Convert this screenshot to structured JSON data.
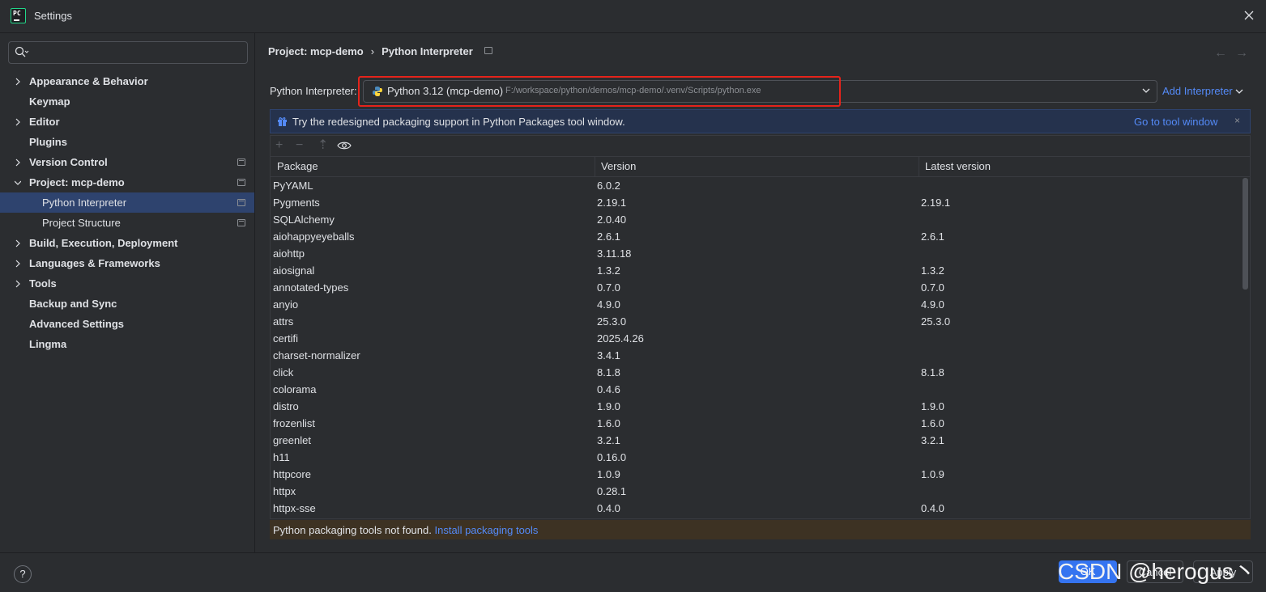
{
  "window": {
    "title": "Settings",
    "app_icon_text": "PC"
  },
  "sidebar": {
    "search_placeholder": "",
    "items": [
      {
        "label": "Appearance & Behavior",
        "expandable": true,
        "expanded": false,
        "level": 0,
        "selected": false,
        "project_icon": false
      },
      {
        "label": "Keymap",
        "expandable": false,
        "level": 0,
        "selected": false,
        "project_icon": false
      },
      {
        "label": "Editor",
        "expandable": true,
        "expanded": false,
        "level": 0,
        "selected": false,
        "project_icon": false
      },
      {
        "label": "Plugins",
        "expandable": false,
        "level": 0,
        "selected": false,
        "project_icon": false
      },
      {
        "label": "Version Control",
        "expandable": true,
        "expanded": false,
        "level": 0,
        "selected": false,
        "project_icon": true
      },
      {
        "label": "Project: mcp-demo",
        "expandable": true,
        "expanded": true,
        "level": 0,
        "selected": false,
        "project_icon": true
      },
      {
        "label": "Python Interpreter",
        "expandable": false,
        "level": 1,
        "selected": true,
        "project_icon": true
      },
      {
        "label": "Project Structure",
        "expandable": false,
        "level": 1,
        "selected": false,
        "project_icon": true
      },
      {
        "label": "Build, Execution, Deployment",
        "expandable": true,
        "expanded": false,
        "level": 0,
        "selected": false,
        "project_icon": false
      },
      {
        "label": "Languages & Frameworks",
        "expandable": true,
        "expanded": false,
        "level": 0,
        "selected": false,
        "project_icon": false
      },
      {
        "label": "Tools",
        "expandable": true,
        "expanded": false,
        "level": 0,
        "selected": false,
        "project_icon": false
      },
      {
        "label": "Backup and Sync",
        "expandable": false,
        "level": 0,
        "selected": false,
        "project_icon": false
      },
      {
        "label": "Advanced Settings",
        "expandable": false,
        "level": 0,
        "selected": false,
        "project_icon": false
      },
      {
        "label": "Lingma",
        "expandable": false,
        "level": 0,
        "selected": false,
        "project_icon": false
      }
    ]
  },
  "breadcrumb": {
    "parent": "Project: mcp-demo",
    "separator": "›",
    "current": "Python Interpreter"
  },
  "interpreter": {
    "label": "Python Interpreter:",
    "name": "Python 3.12 (mcp-demo)",
    "path": "F:/workspace/python/demos/mcp-demo/.venv/Scripts/python.exe",
    "add_label": "Add Interpreter"
  },
  "banner": {
    "message": "Try the redesigned packaging support in Python Packages tool window.",
    "link": "Go to tool window",
    "close": "×"
  },
  "toolbar": {
    "add": "+",
    "remove": "−",
    "upgrade": "⇡"
  },
  "table": {
    "headers": [
      "Package",
      "Version",
      "Latest version"
    ],
    "rows": [
      [
        "PyYAML",
        "6.0.2",
        ""
      ],
      [
        "Pygments",
        "2.19.1",
        "2.19.1"
      ],
      [
        "SQLAlchemy",
        "2.0.40",
        ""
      ],
      [
        "aiohappyeyeballs",
        "2.6.1",
        "2.6.1"
      ],
      [
        "aiohttp",
        "3.11.18",
        ""
      ],
      [
        "aiosignal",
        "1.3.2",
        "1.3.2"
      ],
      [
        "annotated-types",
        "0.7.0",
        "0.7.0"
      ],
      [
        "anyio",
        "4.9.0",
        "4.9.0"
      ],
      [
        "attrs",
        "25.3.0",
        "25.3.0"
      ],
      [
        "certifi",
        "2025.4.26",
        ""
      ],
      [
        "charset-normalizer",
        "3.4.1",
        ""
      ],
      [
        "click",
        "8.1.8",
        "8.1.8"
      ],
      [
        "colorama",
        "0.4.6",
        ""
      ],
      [
        "distro",
        "1.9.0",
        "1.9.0"
      ],
      [
        "frozenlist",
        "1.6.0",
        "1.6.0"
      ],
      [
        "greenlet",
        "3.2.1",
        "3.2.1"
      ],
      [
        "h11",
        "0.16.0",
        ""
      ],
      [
        "httpcore",
        "1.0.9",
        "1.0.9"
      ],
      [
        "httpx",
        "0.28.1",
        ""
      ],
      [
        "httpx-sse",
        "0.4.0",
        "0.4.0"
      ]
    ]
  },
  "warning": {
    "text": "Python packaging tools not found.",
    "link": "Install packaging tools"
  },
  "footer": {
    "help": "?",
    "ok": "OK",
    "cancel": "Cancel",
    "apply": "Apply"
  },
  "watermark": "CSDN @herogus丶",
  "colors": {
    "accent": "#3574f0",
    "link": "#548af7",
    "selection": "#2e436e",
    "highlight_box": "#e5231b",
    "warning_bg": "#3d3223"
  }
}
